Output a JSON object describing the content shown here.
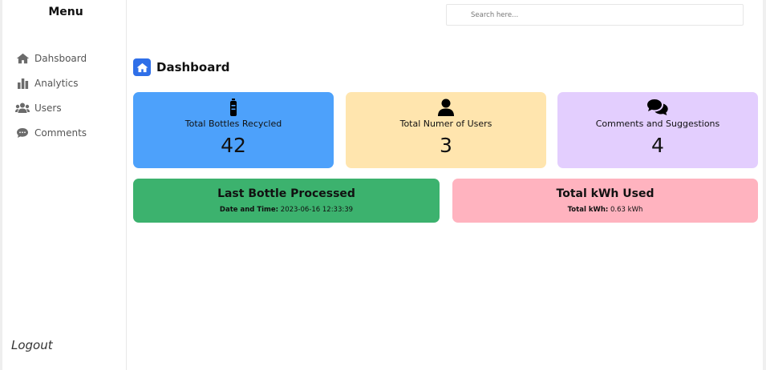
{
  "sidebar": {
    "title": "Menu",
    "items": [
      {
        "label": "Dahsboard",
        "icon": "home-icon"
      },
      {
        "label": "Analytics",
        "icon": "bar-chart-icon"
      },
      {
        "label": "Users",
        "icon": "users-icon"
      },
      {
        "label": "Comments",
        "icon": "comment-icon"
      }
    ],
    "logout": "Logout"
  },
  "search": {
    "placeholder": "Search here..."
  },
  "page": {
    "title": "Dashboard"
  },
  "cards": [
    {
      "label": "Total Bottles Recycled",
      "value": "42",
      "icon": "bottle-icon",
      "color": "#4da1fb"
    },
    {
      "label": "Total Numer of Users",
      "value": "3",
      "icon": "user-icon",
      "color": "#ffe5ae"
    },
    {
      "label": "Comments and Suggestions",
      "value": "4",
      "icon": "comments-icon",
      "color": "#e3cefe"
    }
  ],
  "info": [
    {
      "title": "Last Bottle Processed",
      "detail_label": "Date and Time:",
      "detail_value": "2023-06-16 12:33:39",
      "color": "#3cb26e"
    },
    {
      "title": "Total kWh Used",
      "detail_label": "Total kWh:",
      "detail_value": "0.63 kWh",
      "color": "#ffb3bf"
    }
  ],
  "colors": {
    "accent": "#2f6fe8"
  }
}
